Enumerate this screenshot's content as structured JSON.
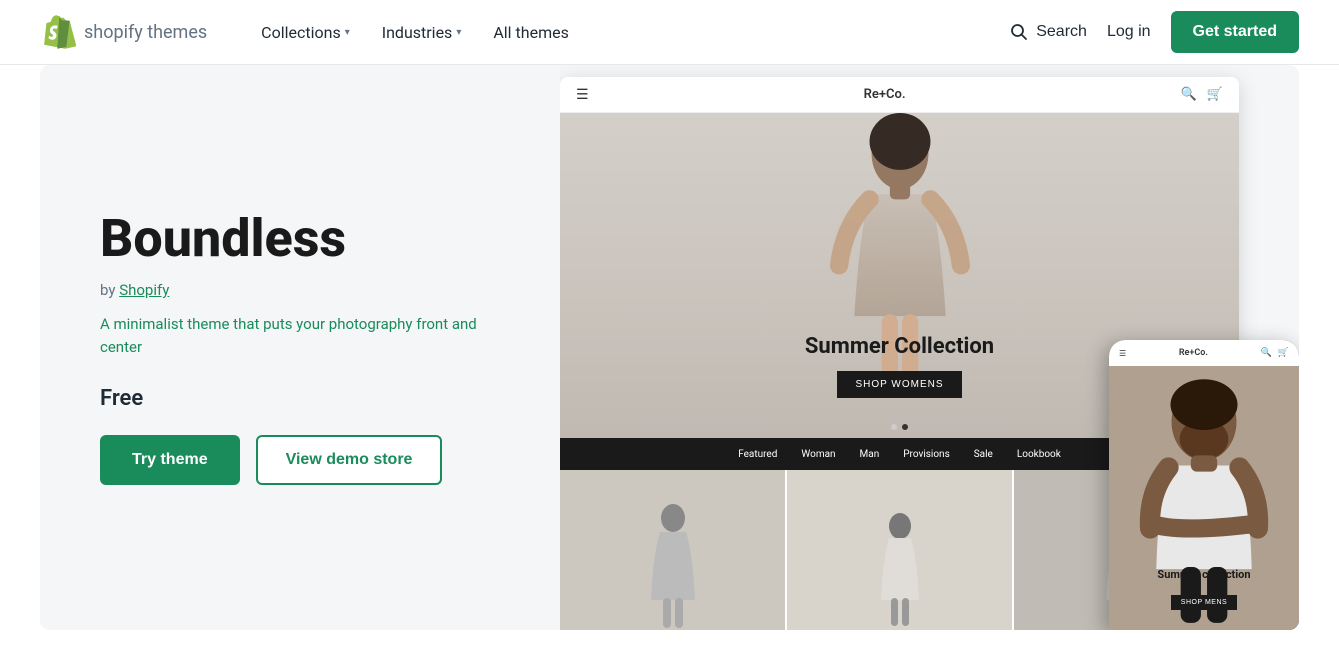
{
  "header": {
    "logo_brand": "shopify",
    "logo_suffix": " themes",
    "nav": [
      {
        "label": "Collections",
        "has_dropdown": true
      },
      {
        "label": "Industries",
        "has_dropdown": true
      },
      {
        "label": "All themes",
        "has_dropdown": false
      }
    ],
    "search_label": "Search",
    "login_label": "Log in",
    "get_started_label": "Get started"
  },
  "theme": {
    "name": "Boundless",
    "by_prefix": "by",
    "by_author": "Shopify",
    "description": "A minimalist theme that puts your photography front and center",
    "price": "Free",
    "try_theme_label": "Try theme",
    "view_demo_label": "View demo store"
  },
  "preview": {
    "desktop": {
      "store_name": "Re+Co.",
      "hero_title": "Summer Collection",
      "hero_shop_btn": "SHOP WOMENS",
      "nav_items": [
        "Featured",
        "Woman",
        "Man",
        "Provisions",
        "Sale",
        "Lookbook"
      ]
    },
    "mobile": {
      "store_name": "Re+Co.",
      "hero_title": "Summer collection",
      "hero_shop_btn": "SHOP MENS"
    }
  },
  "colors": {
    "accent": "#1a8c5b",
    "dark": "#1a1a1a",
    "text_muted": "#637381"
  }
}
